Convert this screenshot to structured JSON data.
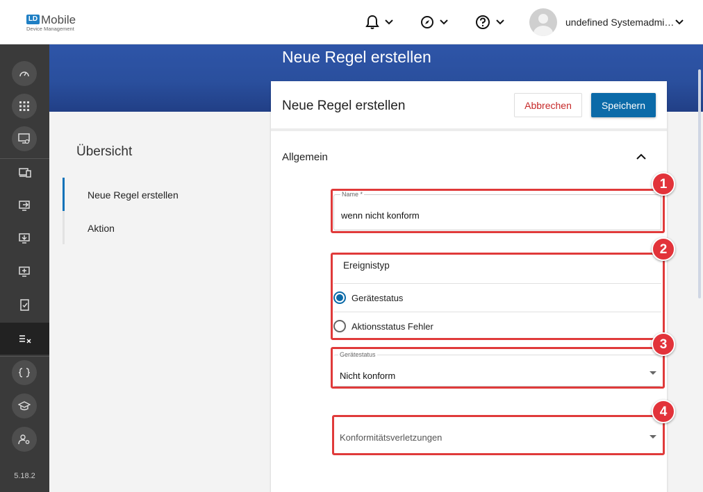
{
  "header": {
    "logo_mark": "LD",
    "logo_title": "Mobile",
    "logo_subtitle": "Device Management",
    "notifications_icon": "bell-icon",
    "compass_icon": "compass-icon",
    "help_icon": "help-icon",
    "user_name": "undefined Systemadmi…"
  },
  "sidebar": {
    "icons": [
      "dashboard-icon",
      "apps-grid-icon",
      "device-screen-icon",
      "devices-icon",
      "screen-arrow-icon",
      "download-icon",
      "screen-plus-icon",
      "checklist-icon",
      "rules-icon",
      "braces-icon",
      "education-icon",
      "user-settings-icon"
    ],
    "version": "5.18.2"
  },
  "banner": {
    "title": "Neue Regel erstellen"
  },
  "left_nav": {
    "heading": "Übersicht",
    "items": [
      {
        "label": "Neue Regel erstellen",
        "active": true
      },
      {
        "label": "Aktion",
        "active": false
      }
    ]
  },
  "card": {
    "title": "Neue Regel erstellen",
    "cancel_label": "Abbrechen",
    "save_label": "Speichern",
    "section_title": "Allgemein"
  },
  "form": {
    "name_label": "Name *",
    "name_value": "wenn nicht konform",
    "event_type_label": "Ereignistyp",
    "event_options": [
      {
        "label": "Gerätestatus",
        "checked": true
      },
      {
        "label": "Aktionsstatus Fehler",
        "checked": false
      }
    ],
    "device_status_label": "Gerätestatus",
    "device_status_value": "Nicht konform",
    "compliance_placeholder": "Konformitätsverletzungen"
  },
  "annotations": [
    "1",
    "2",
    "3",
    "4"
  ],
  "colors": {
    "accent": "#0b6aa8",
    "highlight": "#e03a3a",
    "banner": "#2e55a8",
    "sidebar": "#3a3a3a"
  }
}
